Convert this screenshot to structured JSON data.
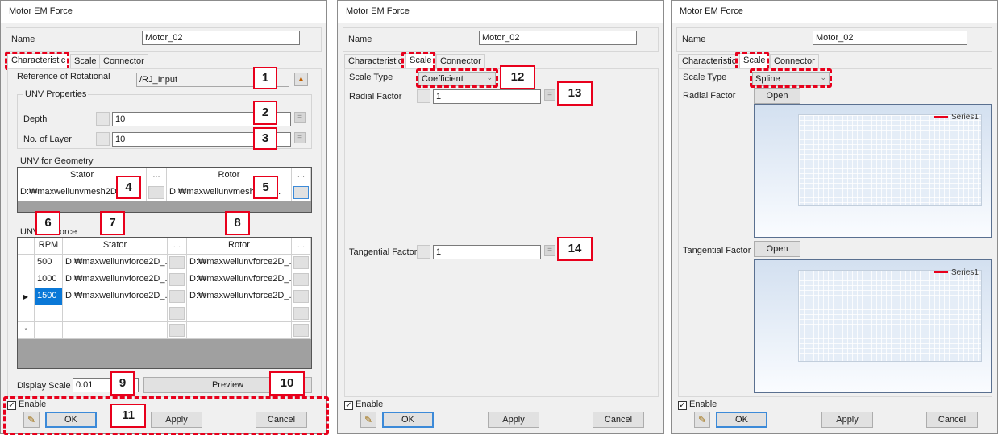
{
  "dialogs": [
    {
      "title": "Motor EM Force",
      "name_label": "Name",
      "name_value": "Motor_02",
      "tabs": [
        "Characteristic",
        "Scale",
        "Connector"
      ],
      "active_tab": "Characteristic",
      "reference_label": "Reference of Rotational",
      "reference_value": "/RJ_Input",
      "unv_properties_label": "UNV Properties",
      "depth_label": "Depth",
      "depth_value": "10",
      "layer_label": "No. of Layer",
      "layer_value": "10",
      "unv_geometry_label": "UNV for Geometry",
      "geometry_columns": [
        "Stator",
        "...",
        "Rotor",
        "..."
      ],
      "geometry_row": {
        "stator": "D:₩maxwellunvmesh2D_s",
        "rotor": "D:₩maxwellunvmesh2D_r..."
      },
      "unv_force_label": "UNV for Force",
      "force_columns": [
        "RPM",
        "Stator",
        "...",
        "Rotor",
        "..."
      ],
      "force_rows": [
        {
          "marker": "",
          "rpm": "500",
          "stator": "D:₩maxwellunvforce2D_...",
          "rotor": "D:₩maxwellunvforce2D_..."
        },
        {
          "marker": "",
          "rpm": "1000",
          "stator": "D:₩maxwellunvforce2D_...",
          "rotor": "D:₩maxwellunvforce2D_..."
        },
        {
          "marker": "▶",
          "rpm": "1500",
          "stator": "D:₩maxwellunvforce2D_...",
          "rotor": "D:₩maxwellunvforce2D_..."
        },
        {
          "marker": "",
          "rpm": "",
          "stator": "",
          "rotor": ""
        },
        {
          "marker": "*",
          "rpm": "",
          "stator": "",
          "rotor": ""
        }
      ],
      "display_scale_label": "Display Scale",
      "display_scale_value": "0.01",
      "preview_label": "Preview",
      "enable_label": "Enable",
      "enable_checked": true,
      "ok_label": "OK",
      "apply_label": "Apply",
      "cancel_label": "Cancel",
      "callouts": [
        "1",
        "2",
        "3",
        "4",
        "5",
        "6",
        "7",
        "8",
        "9",
        "10",
        "11"
      ]
    },
    {
      "title": "Motor EM Force",
      "name_label": "Name",
      "name_value": "Motor_02",
      "tabs": [
        "Characteristic",
        "Scale",
        "Connector"
      ],
      "active_tab": "Scale",
      "scale_type_label": "Scale Type",
      "scale_type_value": "Coefficient",
      "radial_label": "Radial Factor",
      "radial_value": "1",
      "tangential_label": "Tangential Factor",
      "tangential_value": "1",
      "enable_label": "Enable",
      "enable_checked": true,
      "ok_label": "OK",
      "apply_label": "Apply",
      "cancel_label": "Cancel",
      "callouts": [
        "12",
        "13",
        "14"
      ]
    },
    {
      "title": "Motor EM Force",
      "name_label": "Name",
      "name_value": "Motor_02",
      "tabs": [
        "Characteristic",
        "Scale",
        "Connector"
      ],
      "active_tab": "Scale",
      "scale_type_label": "Scale Type",
      "scale_type_value": "Spline",
      "radial_label": "Radial Factor",
      "open_label": "Open",
      "tangential_label": "Tangential Factor",
      "legend_label": "Series1",
      "legend_color": "#e8001c",
      "enable_label": "Enable",
      "enable_checked": true,
      "ok_label": "OK",
      "apply_label": "Apply",
      "cancel_label": "Cancel"
    }
  ],
  "icons": {
    "dropdown": "chevron-down-icon",
    "checkbox": "check-icon",
    "help": "wizard-icon",
    "reference": "reference-picker-icon"
  },
  "colors": {
    "callout": "#e8001c",
    "default_button": "#3c8ad8",
    "selected_cell": "#0a78d7"
  }
}
